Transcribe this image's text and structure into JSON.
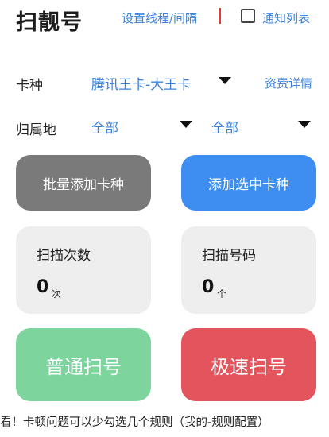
{
  "header": {
    "title": "扫靓号",
    "settings_link": "设置线程/间隔",
    "notify_label": "通知列表"
  },
  "card_type": {
    "label": "卡种",
    "selected": "腾讯王卡-大王卡",
    "details_link": "资费详情"
  },
  "location": {
    "label": "归属地",
    "province": "全部",
    "city": "全部"
  },
  "buttons": {
    "batch_add": "批量添加卡种",
    "add_selected": "添加选中卡种",
    "normal_scan": "普通扫号",
    "fast_scan": "极速扫号"
  },
  "stats": {
    "scan_count": {
      "title": "扫描次数",
      "value": "0",
      "unit": "次"
    },
    "scan_numbers": {
      "title": "扫描号码",
      "value": "0",
      "unit": "个"
    }
  },
  "footer": {
    "note": "看！卡顿问题可以少勾选几个规则（我的-规则配置）"
  },
  "colors": {
    "link": "#3b82d9",
    "divider": "#e53935",
    "gray_button": "#7a7a7a",
    "blue_button": "#3d8ef0",
    "green_button": "#7dd49c",
    "red_button": "#e3545c"
  }
}
